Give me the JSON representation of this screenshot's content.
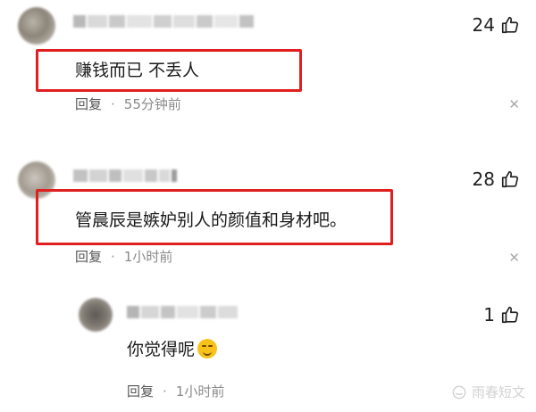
{
  "reply_label": "回复",
  "dot": "·",
  "close_glyph": "✕",
  "comments": [
    {
      "text": "赚钱而已 不丢人",
      "time": "55分钟前",
      "likes": "24"
    },
    {
      "text": "管晨辰是嫉妒别人的颜值和身材吧。",
      "time": "1小时前",
      "likes": "28"
    },
    {
      "text": "你觉得呢",
      "time": "1小时前",
      "likes": "1"
    }
  ],
  "watermark": "雨春短文",
  "colors": {
    "highlight": "#e0201f",
    "meta_text": "#8a8a8a",
    "emoji": "#f7c21a"
  }
}
